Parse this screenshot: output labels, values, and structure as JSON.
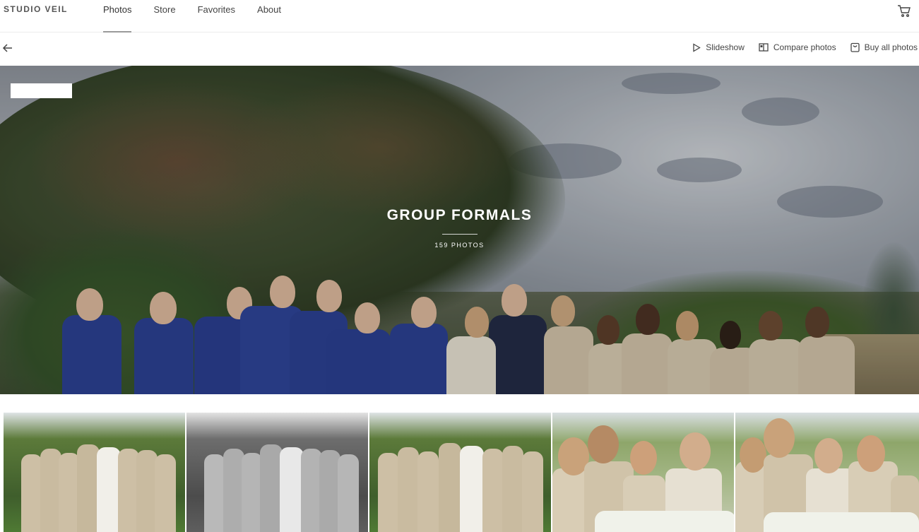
{
  "brand": "STUDIO VEIL",
  "nav": {
    "links": [
      {
        "label": "Photos",
        "active": true
      },
      {
        "label": "Store",
        "active": false
      },
      {
        "label": "Favorites",
        "active": false
      },
      {
        "label": "About",
        "active": false
      }
    ],
    "cart_icon": "cart-icon"
  },
  "toolbar": {
    "back_icon": "back-arrow-icon",
    "slideshow": {
      "label": "Slideshow",
      "icon": "play-icon"
    },
    "compare": {
      "label": "Compare photos",
      "icon": "compare-icon"
    },
    "buy_all": {
      "label": "Buy all photos",
      "icon": "bag-icon"
    }
  },
  "album": {
    "title": "GROUP FORMALS",
    "count": "159 PHOTOS"
  },
  "thumbnails": [
    {
      "alt": "bridesmaids group",
      "style": "color"
    },
    {
      "alt": "bridesmaids group",
      "style": "bw"
    },
    {
      "alt": "bridesmaids group",
      "style": "color"
    },
    {
      "alt": "bridesmaids close",
      "style": "color"
    },
    {
      "alt": "bridesmaids close",
      "style": "color"
    }
  ],
  "colors": {
    "suit": "#2b3f8f",
    "dress": "#cdbfa5",
    "foliage": "#3f5a2e"
  }
}
